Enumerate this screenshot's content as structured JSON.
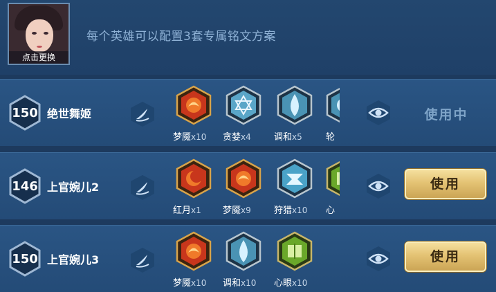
{
  "header": {
    "avatar_caption": "点击更换",
    "hint": "每个英雄可以配置3套专属铭文方案"
  },
  "schemes": [
    {
      "level": "150",
      "name": "绝世舞姬",
      "action": "使用中",
      "runes": [
        {
          "name": "梦魇",
          "count": "x10",
          "color": "red"
        },
        {
          "name": "贪婪",
          "count": "x4",
          "color": "blue"
        },
        {
          "name": "调和",
          "count": "x5",
          "color": "blue"
        },
        {
          "name": "轮",
          "count": "",
          "color": "blue"
        }
      ]
    },
    {
      "level": "146",
      "name": "上官婉儿2",
      "action": "使用",
      "runes": [
        {
          "name": "红月",
          "count": "x1",
          "color": "red"
        },
        {
          "name": "梦魇",
          "count": "x9",
          "color": "red"
        },
        {
          "name": "狩猎",
          "count": "x10",
          "color": "blue"
        },
        {
          "name": "心",
          "count": "",
          "color": "green"
        }
      ]
    },
    {
      "level": "150",
      "name": "上官婉儿3",
      "action": "使用",
      "runes": [
        {
          "name": "梦魇",
          "count": "x10",
          "color": "red"
        },
        {
          "name": "调和",
          "count": "x10",
          "color": "blue"
        },
        {
          "name": "心眼",
          "count": "x10",
          "color": "green"
        }
      ]
    }
  ],
  "colors": {
    "background": "#1d3a5e",
    "row": "#2a5584",
    "hint_text": "#8fb2d6",
    "status_text": "#7ea4c8",
    "button_gold": "#e4c374"
  }
}
